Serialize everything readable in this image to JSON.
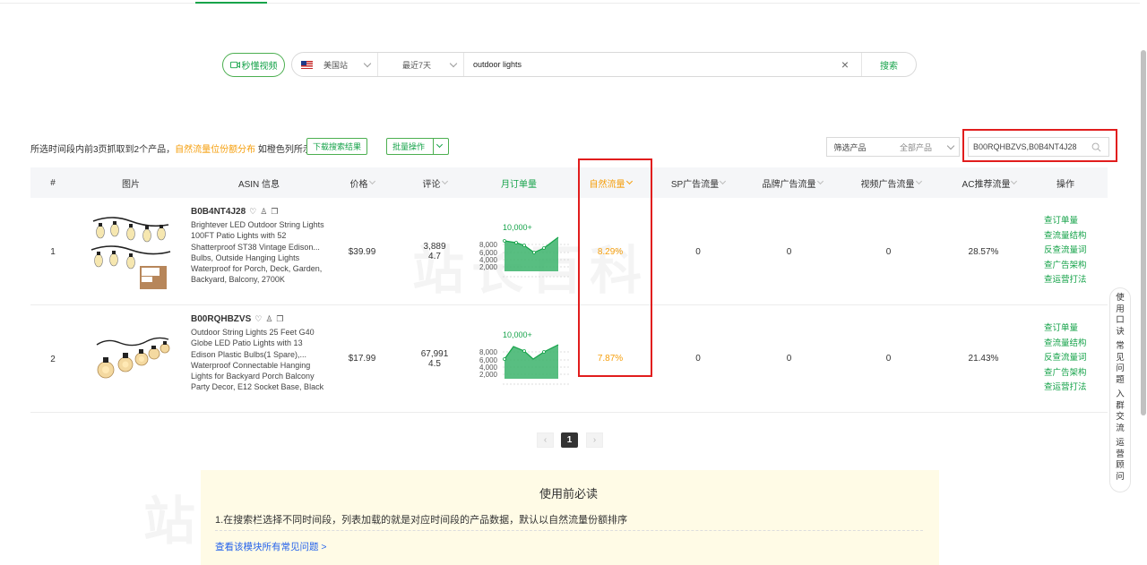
{
  "toolbar": {
    "video_button": "秒懂视频",
    "site": "美国站",
    "period": "最近7天",
    "query": "outdoor lights",
    "search_button": "搜索"
  },
  "summary": {
    "text_prefix": "所选时间段内前3页抓取到2个产品，",
    "text_highlight": "自然流量位份额分布",
    "text_suffix": " 如橙色列所示",
    "download_button": "下载搜索结果",
    "batch_button": "批量操作",
    "filter_label": "筛选产品",
    "filter_value": "全部产品",
    "asin_filter_value": "B00RQHBZVS,B0B4NT4J28"
  },
  "table": {
    "headers": {
      "index": "#",
      "image": "图片",
      "asin": "ASIN 信息",
      "price": "价格",
      "reviews": "评论",
      "monthly": "月订单量",
      "organic": "自然流量",
      "sp": "SP广告流量",
      "brand": "品牌广告流量",
      "video": "视频广告流量",
      "ac": "AC推荐流量",
      "ops": "操作"
    },
    "rows": [
      {
        "index": "1",
        "asin": "B0B4NT4J28",
        "title": "Brightever LED Outdoor String Lights 100FT Patio Lights with 52 Shatterproof ST38 Vintage Edison... Bulbs, Outside Hanging Lights Waterproof for Porch, Deck, Garden, Backyard, Balcony, 2700K",
        "price": "$39.99",
        "review_count": "3,889",
        "rating": "4.7",
        "monthly_label": "10,000+",
        "organic": "8.29%",
        "sp": "0",
        "brand": "0",
        "video": "0",
        "ac": "28.57%",
        "ops": [
          "查订单量",
          "查流量结构",
          "反查流量词",
          "查广告架构",
          "查运营打法"
        ]
      },
      {
        "index": "2",
        "asin": "B00RQHBZVS",
        "title": "Outdoor String Lights 25 Feet G40 Globe LED Patio Lights with 13 Edison Plastic Bulbs(1 Spare),... Waterproof Connectable Hanging Lights for Backyard Porch Balcony Party Decor, E12 Socket Base, Black",
        "price": "$17.99",
        "review_count": "67,991",
        "rating": "4.5",
        "monthly_label": "10,000+",
        "organic": "7.87%",
        "sp": "0",
        "brand": "0",
        "video": "0",
        "ac": "21.43%",
        "ops": [
          "查订单量",
          "查流量结构",
          "反查流量词",
          "查广告架构",
          "查运营打法"
        ]
      }
    ],
    "chart_ticks": [
      "8,000",
      "6,000",
      "4,000",
      "2,000"
    ]
  },
  "pagination": {
    "current": "1",
    "prev": "‹",
    "next": "›"
  },
  "notice": {
    "title": "使用前必读",
    "body": "1.在搜索栏选择不同时间段，列表加载的就是对应时间段的产品数据，默认以自然流量份额排序",
    "link": "查看该模块所有常见问题 >"
  },
  "sidetab": {
    "items": [
      "使用口诀",
      "常见问题",
      "入群交流",
      "运营顾问"
    ]
  },
  "watermark": "站长百科",
  "colors": {
    "accent": "#16a34a",
    "highlight": "#f59e0b",
    "annotation": "#e11d1d",
    "link": "#2563eb"
  }
}
